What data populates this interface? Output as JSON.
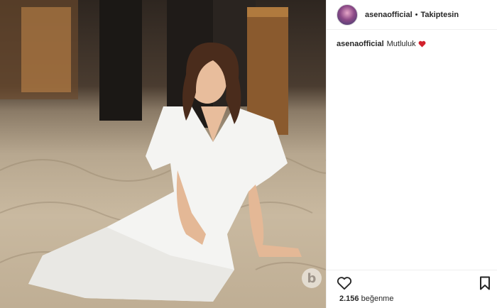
{
  "post": {
    "username": "asenaofficial",
    "separator": "•",
    "follow_status": "Takiptesin",
    "caption_text": "Mutluluk",
    "likes_count": "2.156",
    "likes_label": "beğenme"
  },
  "watermark": {
    "letter": "b"
  },
  "colors": {
    "text": "#262626",
    "border": "#efefef",
    "heart": "#ed4956"
  },
  "icons": {
    "like": "heart-outline-icon",
    "save": "bookmark-icon",
    "caption_emoji": "red-heart-emoji-icon"
  }
}
